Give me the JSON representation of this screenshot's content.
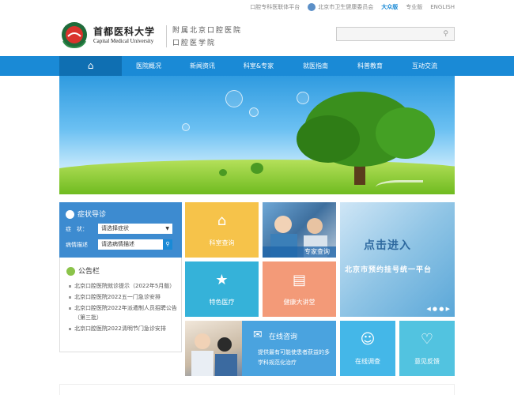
{
  "topbar": {
    "links": [
      "口腔专科医联体平台",
      "北京市卫生健康委员会",
      "大众版",
      "专业版",
      "ENGLISH"
    ]
  },
  "header": {
    "cn_name": "首都医科大学",
    "en_name": "Capital Medical University",
    "sub_line1": "附属北京口腔医院",
    "sub_line2": "口腔医学院",
    "search_placeholder": ""
  },
  "nav": {
    "home_icon": "home-icon",
    "items": [
      "医院概况",
      "新闻资讯",
      "科室&专家",
      "就医指南",
      "科普教育",
      "互动交流"
    ]
  },
  "symptom": {
    "title": "症状导诊",
    "field1_label": "症　状：",
    "field1_value": "请选择症状",
    "field2_label": "病情描述",
    "field2_value": "请选病情描述"
  },
  "notice": {
    "title": "公告栏",
    "items": [
      "北京口腔医院就诊提示（2022年5月版）",
      "北京口腔医院2022五一门急诊安排",
      "北京口腔医院2022年派遣制人员招聘公告（第三批）",
      "北京口腔医院2022清明节门急诊安排"
    ]
  },
  "tiles": {
    "dept": "科室查询",
    "expert": "专家查询",
    "special": "特色医疗",
    "health": "健康大讲堂",
    "online_title": "在线咨询",
    "online_desc": "提供最有可能使患者获益的多学科规范化治疗",
    "survey": "在线调查",
    "feedback": "意见反馈"
  },
  "registration": {
    "line1": "点击进入",
    "line2": "北京市预约挂号统一平台"
  },
  "colors": {
    "primary": "#1a8ad6",
    "dept_tile": "#f6c34a",
    "special_tile": "#35b2d9",
    "health_tile": "#f39a78",
    "survey_tile": "#44b7e8",
    "feedback_tile": "#52c3e0"
  }
}
